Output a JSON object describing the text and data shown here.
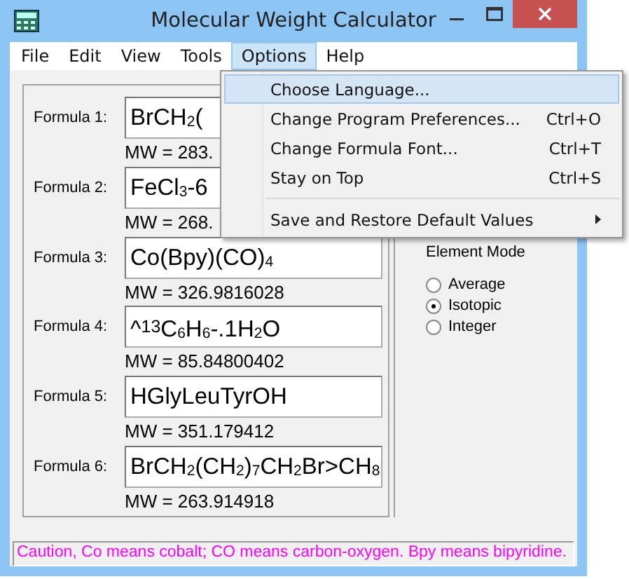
{
  "window": {
    "title": "Molecular Weight Calculator"
  },
  "menu_bar": [
    {
      "label": "File",
      "selected": false
    },
    {
      "label": "Edit",
      "selected": false
    },
    {
      "label": "View",
      "selected": false
    },
    {
      "label": "Tools",
      "selected": false
    },
    {
      "label": "Options",
      "selected": true
    },
    {
      "label": "Help",
      "selected": false
    }
  ],
  "options_menu": [
    {
      "kind": "item",
      "label": "Choose Language...",
      "submenu": false,
      "highlighted": true
    },
    {
      "kind": "item",
      "label": "Change Program Preferences...",
      "shortcut": "Ctrl+O",
      "submenu": false,
      "highlighted": false
    },
    {
      "kind": "item",
      "label": "Change Formula Font...",
      "shortcut": "Ctrl+T",
      "submenu": false,
      "highlighted": false
    },
    {
      "kind": "item",
      "label": "Stay on Top",
      "shortcut": "Ctrl+S",
      "submenu": false,
      "highlighted": false
    },
    {
      "kind": "separator"
    },
    {
      "kind": "item",
      "label": "Save and Restore Default Values",
      "submenu": true,
      "highlighted": false
    }
  ],
  "formulas": [
    {
      "label": "Formula 1:",
      "value": "BrCH$_{2}$(",
      "mw": "MW = 283."
    },
    {
      "label": "Formula 2:",
      "value": "FeCl$_{3}$-6",
      "mw": "MW = 268."
    },
    {
      "label": "Formula 3:",
      "value": "Co(Bpy)(CO)$_{4}$",
      "mw": "MW = 326.9816028"
    },
    {
      "label": "Formula 4:",
      "value": "^$^{13}$C$_{6}$H$_{6}$-.1H$_{2}$O",
      "mw": "MW = 85.84800402"
    },
    {
      "label": "Formula 5:",
      "value": "HGlyLeuTyrOH",
      "mw": "MW = 351.179412"
    },
    {
      "label": "Formula 6:",
      "value": "BrCH$_{2}$(CH$_{2}$)$_{7}$CH$_{2}$Br>CH$_{8}$",
      "mw": "MW = 263.914918"
    }
  ],
  "element_mode": {
    "label": "Element Mode",
    "options": [
      {
        "label": "Average",
        "selected": false
      },
      {
        "label": "Isotopic",
        "selected": true
      },
      {
        "label": "Integer",
        "selected": false
      }
    ]
  },
  "status_bar": "Caution, Co means cobalt; CO means carbon-oxygen.  Bpy means bipyridine."
}
